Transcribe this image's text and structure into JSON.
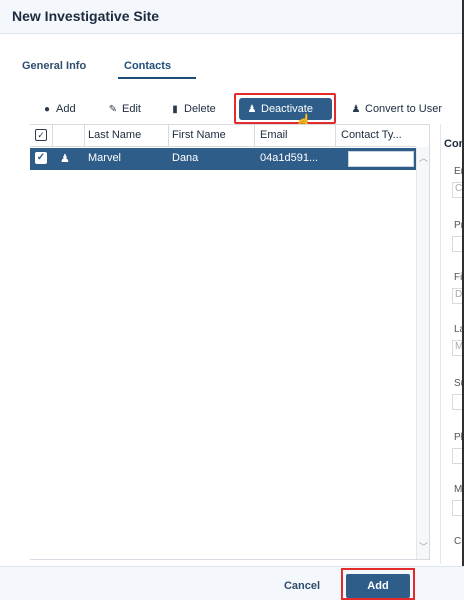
{
  "dialog": {
    "title": "New Investigative Site"
  },
  "tabs": [
    {
      "label": "General Info"
    },
    {
      "label": "Contacts"
    }
  ],
  "toolbar": {
    "add": "Add",
    "edit": "Edit",
    "delete": "Delete",
    "deactivate": "Deactivate",
    "convert": "Convert to User"
  },
  "grid": {
    "columns": [
      "Last Name",
      "First Name",
      "Email",
      "Contact Ty..."
    ],
    "rows": [
      {
        "last_name": "Marvel",
        "first_name": "Dana",
        "email": "04a1d591...",
        "contact_type": ""
      }
    ]
  },
  "right_panel": {
    "title": "Con",
    "labels": [
      "En",
      "Pr",
      "Fi",
      "La",
      "Su",
      "Pł",
      "M",
      "C"
    ],
    "values": [
      "C",
      "",
      "D",
      "M",
      "",
      "",
      "",
      ""
    ]
  },
  "footer": {
    "cancel": "Cancel",
    "add": "Add"
  },
  "colors": {
    "accent": "#2f5d8a",
    "highlight": "#e32b2b"
  }
}
